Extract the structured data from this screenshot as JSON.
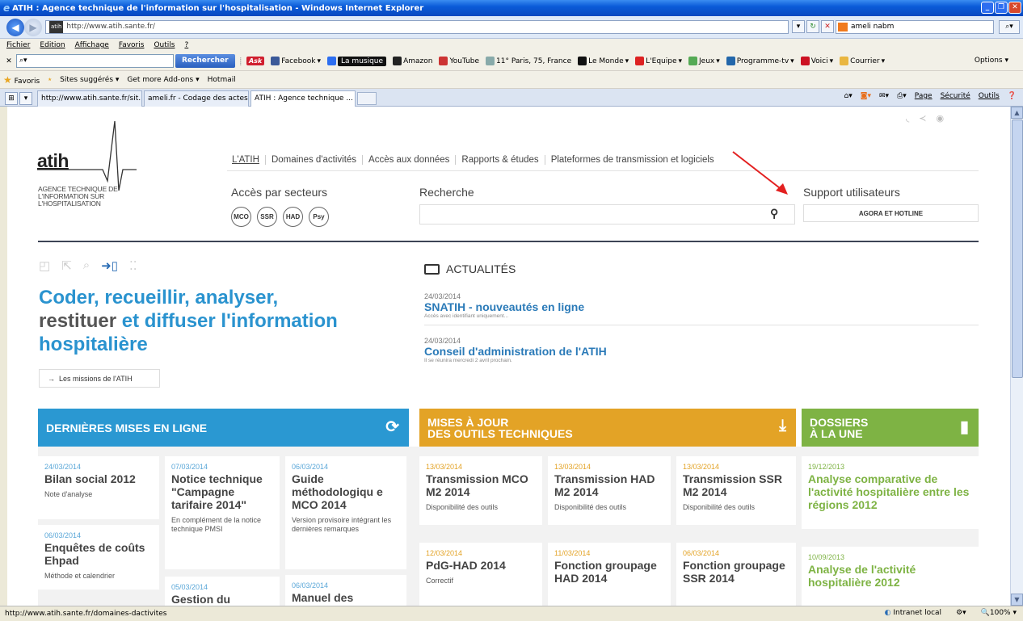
{
  "window": {
    "title": "ATIH : Agence technique de l'information sur l'hospitalisation - Windows Internet Explorer",
    "url": "http://www.atih.sante.fr/",
    "url_favicon": "atih",
    "search_value": "ameli nabm"
  },
  "menu": [
    "Fichier",
    "Edition",
    "Affichage",
    "Favoris",
    "Outils",
    "?"
  ],
  "ask_toolbar": {
    "search_button": "Rechercher",
    "ask_logo": "Ask",
    "items": [
      "Facebook",
      "La musique",
      "Amazon",
      "YouTube",
      "11° Paris, 75, France",
      "Le Monde",
      "L'Equipe",
      "Jeux",
      "Programme-tv",
      "Voici",
      "Courrier"
    ],
    "options": "Options"
  },
  "favorites_bar": {
    "favorites": "Favoris",
    "items": [
      "Sites suggérés",
      "Get more Add-ons",
      "Hotmail"
    ]
  },
  "tabs": [
    {
      "label": "http://www.atih.sante.fr/sit..."
    },
    {
      "label": "ameli.fr - Codage des actes ..."
    },
    {
      "label": "ATIH : Agence technique ..."
    }
  ],
  "command_bar": [
    "Page",
    "Sécurité",
    "Outils"
  ],
  "site": {
    "logo": "atih",
    "logo_subtitle": "AGENCE TECHNIQUE DE L'INFORMATION SUR L'HOSPITALISATION",
    "nav": [
      "L'ATIH",
      "Domaines d'activités",
      "Accès aux données",
      "Rapports & études",
      "Plateformes de transmission et logiciels"
    ],
    "sectors_title": "Accès par secteurs",
    "sectors": [
      "MCO",
      "SSR",
      "HAD",
      "Psy"
    ],
    "search_title": "Recherche",
    "support_title": "Support utilisateurs",
    "support_button": "AGORA ET HOTLINE",
    "hero_part1": "Coder, recueillir, analyser,",
    "hero_part2": "restituer",
    "hero_part3": " et diffuser l'information hospitalière",
    "missions_button": "Les missions de l'ATIH",
    "news_title": "ACTUALITÉS",
    "news": [
      {
        "date": "24/03/2014",
        "title": "SNATIH - nouveautés en ligne",
        "desc": "Accès avec identifiant uniquement..."
      },
      {
        "date": "24/03/2014",
        "title": "Conseil d'administration de l'ATIH",
        "desc": "Il se réunira mercredi 2 avril prochain."
      }
    ],
    "bands": {
      "latest": "DERNIÈRES MISES EN LIGNE",
      "tools_line1": "MISES À JOUR",
      "tools_line2": "DES OUTILS TECHNIQUES",
      "files_line1": "DOSSIERS",
      "files_line2": "À LA UNE"
    },
    "latest_cards": [
      {
        "date": "24/03/2014",
        "title": "Bilan social 2012",
        "desc": "Note d'analyse"
      },
      {
        "date": "07/03/2014",
        "title": "Notice technique \"Campagne tarifaire 2014\"",
        "desc": "En complément de la notice technique PMSI"
      },
      {
        "date": "06/03/2014",
        "title": "Guide méthodologiqu e MCO 2014",
        "desc": "Version provisoire intégrant les dernières remarques"
      },
      {
        "date": "06/03/2014",
        "title": "Enquêtes de coûts Ehpad",
        "desc": "Méthode et calendrier"
      },
      {
        "date": "05/03/2014",
        "title": "Gestion du",
        "desc": ""
      },
      {
        "date": "06/03/2014",
        "title": "Manuel des",
        "desc": ""
      }
    ],
    "tools_cards": [
      {
        "date": "13/03/2014",
        "title": "Transmission MCO M2 2014",
        "desc": "Disponibilité des outils"
      },
      {
        "date": "13/03/2014",
        "title": "Transmission HAD M2 2014",
        "desc": "Disponibilité des outils"
      },
      {
        "date": "13/03/2014",
        "title": "Transmission SSR M2 2014",
        "desc": "Disponibilité des outils"
      },
      {
        "date": "12/03/2014",
        "title": "PdG-HAD 2014",
        "desc": "Correctif"
      },
      {
        "date": "11/03/2014",
        "title": "Fonction groupage HAD 2014",
        "desc": ""
      },
      {
        "date": "06/03/2014",
        "title": "Fonction groupage SSR 2014",
        "desc": ""
      }
    ],
    "files_cards": [
      {
        "date": "19/12/2013",
        "title": "Analyse comparative de l'activité hospitalière entre les régions 2012"
      },
      {
        "date": "10/09/2013",
        "title": "Analyse de l'activité hospitalière 2012"
      }
    ]
  },
  "status": {
    "url": "http://www.atih.sante.fr/domaines-dactivites",
    "zone": "Intranet local",
    "zoom": "100%"
  },
  "colors": {
    "blue": "#2a98d2",
    "orange": "#e3a326",
    "green": "#7eb344",
    "annotation_arrow": "#e32020"
  }
}
